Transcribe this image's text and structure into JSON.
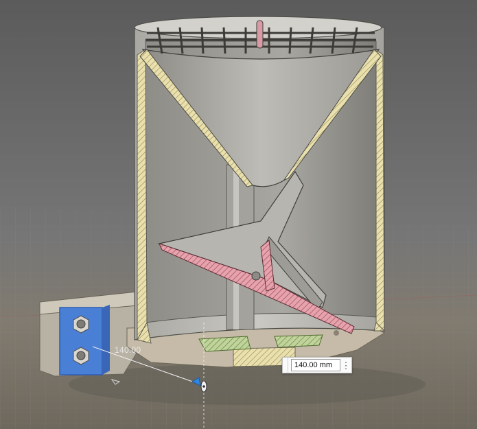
{
  "dimension": {
    "label": "140.00",
    "input_value": "140.00 mm"
  },
  "icons": {
    "menu": "kebab-menu-icon",
    "drag": "drag-arrow-icon",
    "rotate": "rotate-handle-icon"
  }
}
